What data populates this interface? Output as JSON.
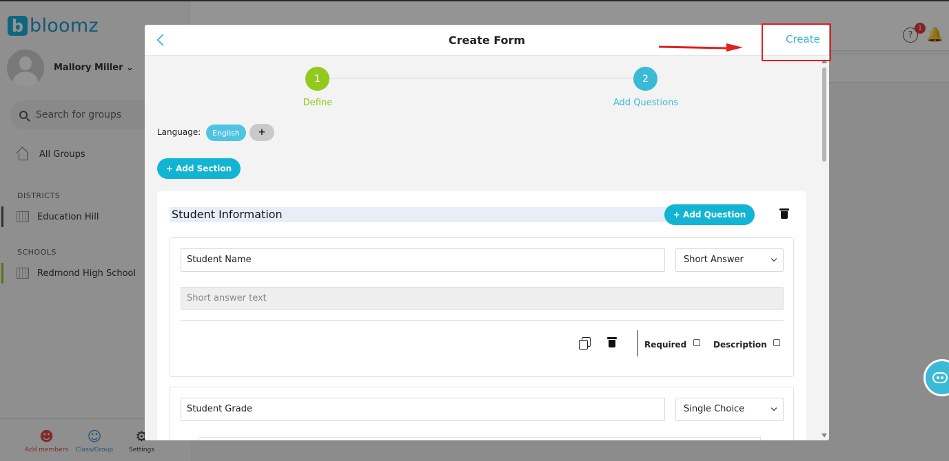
{
  "app": {
    "logo_letter": "b",
    "logo_text": "bloomz",
    "user_name": "Mallory Miller",
    "search_placeholder": "Search for groups",
    "all_groups": "All Groups",
    "districts_label": "DISTRICTS",
    "district_item": "Education Hill",
    "schools_label": "SCHOOLS",
    "school_item": "Redmond High School",
    "bottom": {
      "add_members": "Add members",
      "class_group": "Class/Group",
      "settings": "Settings"
    },
    "notification_count": "1",
    "colors": {
      "brand": "#1ab0dd",
      "accent": "#12b4d4",
      "step_done": "#93c91d",
      "badge": "#e23d3d"
    }
  },
  "modal": {
    "title": "Create Form",
    "create_label": "Create",
    "steps": [
      {
        "number": "1",
        "label": "Define"
      },
      {
        "number": "2",
        "label": "Add Questions"
      }
    ],
    "language_label": "Language:",
    "language_selected": "English",
    "language_add": "+",
    "add_section_label": "+ Add Section",
    "section": {
      "title": "Student Information",
      "add_question_label": "+ Add Question",
      "questions": [
        {
          "text": "Student Name",
          "type": "Short Answer",
          "answer_placeholder": "Short answer text",
          "required_label": "Required",
          "description_label": "Description"
        },
        {
          "text": "Student Grade",
          "type": "Single Choice"
        }
      ]
    }
  }
}
